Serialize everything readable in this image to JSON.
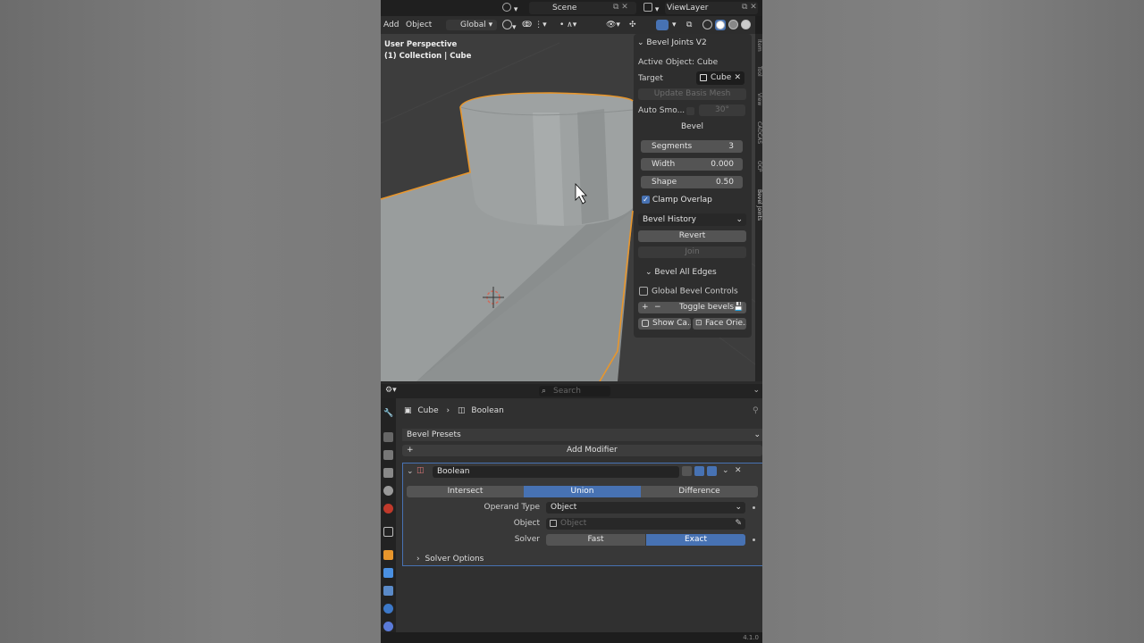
{
  "topbar": {
    "scene": "Scene",
    "viewlayer": "ViewLayer"
  },
  "viewport": {
    "header": {
      "add": "Add",
      "object": "Object",
      "orientation": "Global"
    },
    "info_line1": "User Perspective",
    "info_line2": "(1) Collection | Cube"
  },
  "npanel": {
    "title": "Bevel Joints V2",
    "active_object": "Active Object: Cube",
    "target_label": "Target",
    "target_value": "Cube",
    "update_basis": "Update Basis Mesh",
    "auto_smooth_label": "Auto Smo...",
    "auto_smooth_angle": "30°",
    "bevel_header": "Bevel",
    "segments_label": "Segments",
    "segments_value": "3",
    "width_label": "Width",
    "width_value": "0.000",
    "shape_label": "Shape",
    "shape_value": "0.50",
    "clamp_overlap": "Clamp Overlap",
    "bevel_history": "Bevel History",
    "revert": "Revert",
    "join": "Join",
    "bevel_all_edges": "Bevel All Edges",
    "global_bevel_controls": "Global Bevel Controls",
    "toggle_bevels": "Toggle bevels",
    "show_cage": "Show Ca...",
    "face_orientation": "Face Orie...",
    "tabs": [
      "Item",
      "Tool",
      "View",
      "CADCAS",
      "OCP",
      "Bevel Joints"
    ]
  },
  "properties": {
    "search_placeholder": "Search",
    "breadcrumb_object": "Cube",
    "breadcrumb_modifier": "Boolean",
    "bevel_presets": "Bevel Presets",
    "add_modifier": "Add Modifier",
    "modifier_name": "Boolean",
    "operations": [
      "Intersect",
      "Union",
      "Difference"
    ],
    "operand_type_label": "Operand Type",
    "operand_type_value": "Object",
    "object_label": "Object",
    "object_placeholder": "Object",
    "solver_label": "Solver",
    "solver_options": [
      "Fast",
      "Exact"
    ],
    "solver_options_panel": "Solver Options",
    "version": "4.1.0"
  },
  "colors": {
    "accent": "#4772b3",
    "selection_outline": "#e8962c",
    "panel": "#2e2e2e"
  }
}
